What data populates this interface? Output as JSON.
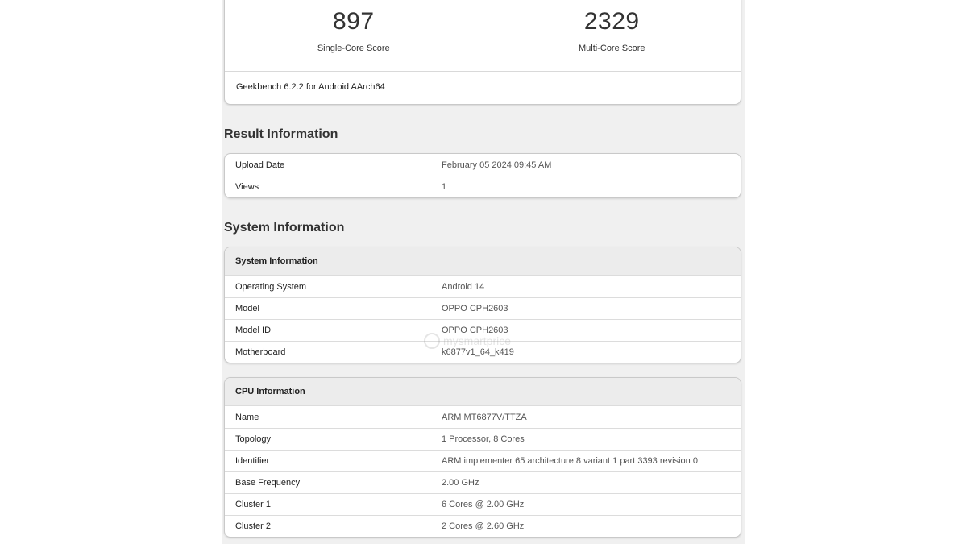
{
  "scores": {
    "single": {
      "value": "897",
      "label": "Single-Core Score"
    },
    "multi": {
      "value": "2329",
      "label": "Multi-Core Score"
    },
    "footer": "Geekbench 6.2.2 for Android AArch64"
  },
  "result_info": {
    "heading": "Result Information",
    "rows": [
      {
        "k": "Upload Date",
        "v": "February 05 2024 09:45 AM"
      },
      {
        "k": "Views",
        "v": "1"
      }
    ]
  },
  "system_info": {
    "heading": "System Information",
    "card_title": "System Information",
    "rows": [
      {
        "k": "Operating System",
        "v": "Android 14"
      },
      {
        "k": "Model",
        "v": "OPPO CPH2603"
      },
      {
        "k": "Model ID",
        "v": "OPPO CPH2603"
      },
      {
        "k": "Motherboard",
        "v": "k6877v1_64_k419"
      }
    ]
  },
  "cpu_info": {
    "card_title": "CPU Information",
    "rows": [
      {
        "k": "Name",
        "v": "ARM MT6877V/TTZA"
      },
      {
        "k": "Topology",
        "v": "1 Processor, 8 Cores"
      },
      {
        "k": "Identifier",
        "v": "ARM implementer 65 architecture 8 variant 1 part 3393 revision 0"
      },
      {
        "k": "Base Frequency",
        "v": "2.00 GHz"
      },
      {
        "k": "Cluster 1",
        "v": "6 Cores @ 2.00 GHz"
      },
      {
        "k": "Cluster 2",
        "v": "2 Cores @ 2.60 GHz"
      }
    ]
  },
  "watermark": "mysmartprice"
}
